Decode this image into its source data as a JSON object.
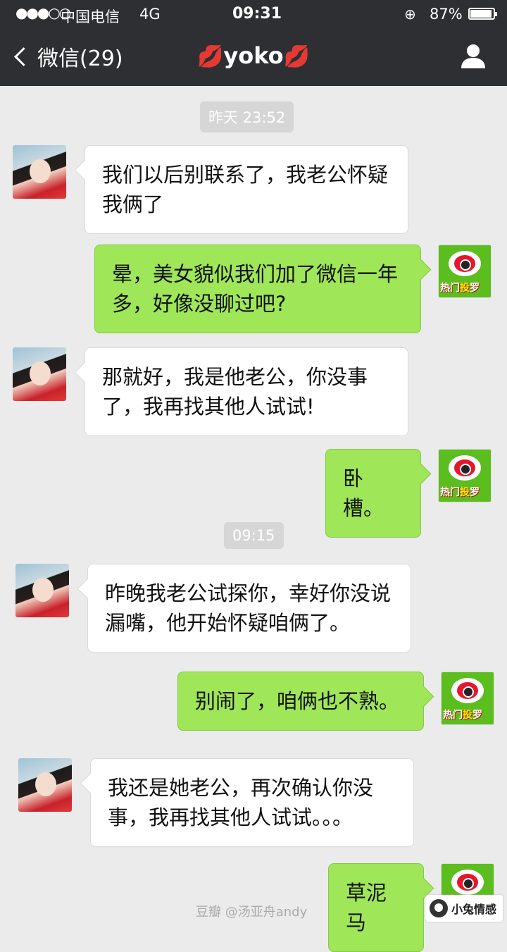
{
  "status_bar": {
    "signal": "●●●○○",
    "carrier": "中国电信",
    "network": "4G",
    "time": "09:31",
    "battery_percent": "87%"
  },
  "nav": {
    "back_label": "微信(29)",
    "title": "yoko",
    "title_decoration": "lips-icon"
  },
  "timestamps": [
    "昨天 23:52",
    "09:15"
  ],
  "messages": [
    {
      "sender": "her",
      "text": "我们以后别联系了，我老公怀疑我俩了"
    },
    {
      "sender": "me",
      "text": "晕，美女貌似我们加了微信一年多，好像没聊过吧?"
    },
    {
      "sender": "her",
      "text": "那就好，我是他老公，你没事了，我再找其他人试试!"
    },
    {
      "sender": "me",
      "text": "卧槽。"
    },
    {
      "sender": "her",
      "text": "昨晚我老公试探你，幸好你没说漏嘴，他开始怀疑咱俩了。"
    },
    {
      "sender": "me",
      "text": "别闹了，咱俩也不熟。"
    },
    {
      "sender": "her",
      "text": "我还是她老公，再次确认你没事，我再找其他人试试。。。"
    },
    {
      "sender": "me",
      "text": "草泥马"
    }
  ],
  "my_avatar_text": [
    "热门",
    "投",
    "罗"
  ],
  "watermark": "豆瓣 @汤亚舟andy",
  "site_logo": "小兔情感",
  "colors": {
    "header": "#2e2f33",
    "background": "#ebebeb",
    "outgoing_bubble": "#9fe658",
    "incoming_bubble": "#ffffff"
  }
}
